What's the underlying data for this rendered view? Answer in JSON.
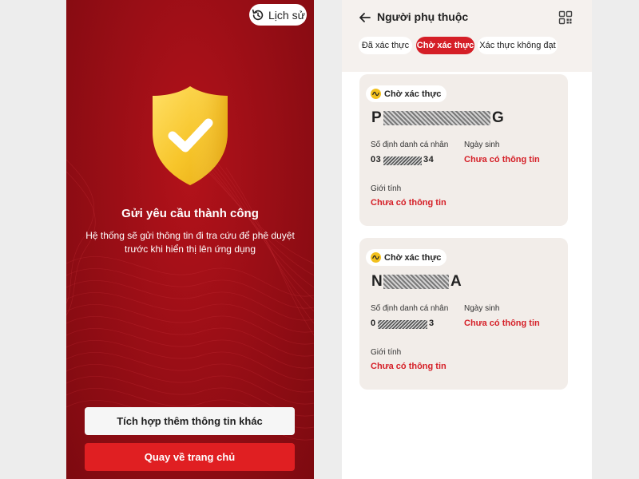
{
  "left_screen": {
    "history_label": "Lịch sử",
    "title": "Gửi yêu cầu thành công",
    "description": "Hệ thống sẽ gửi thông tin đi tra cứu để phê duyệt trước khi hiển thị lên ứng dụng",
    "btn_more_info": "Tích hợp thêm thông tin khác",
    "btn_home": "Quay về trang chủ",
    "colors": {
      "background": "#9a0e16",
      "primary_button": "#e01f22",
      "shield": "#f7c52a"
    }
  },
  "right_screen": {
    "title": "Người phụ thuộc",
    "tabs": [
      {
        "label": "Đã xác thực",
        "active": false
      },
      {
        "label": "Chờ xác thực",
        "active": true
      },
      {
        "label": "Xác thực không đạt",
        "active": false
      }
    ],
    "cards": [
      {
        "status": "Chờ xác thực",
        "name_first": "P",
        "name_last": "G",
        "id_label": "Số định danh cá nhân",
        "id_prefix": "03",
        "id_suffix": "34",
        "dob_label": "Ngày sinh",
        "dob_value": "Chưa có thông tin",
        "gender_label": "Giới tính",
        "gender_value": "Chưa có thông tin"
      },
      {
        "status": "Chờ xác thực",
        "name_first": "N",
        "name_last": "A",
        "id_label": "Số định danh cá nhân",
        "id_prefix": "0",
        "id_suffix": "3",
        "dob_label": "Ngày sinh",
        "dob_value": "Chưa có thông tin",
        "gender_label": "Giới tính",
        "gender_value": "Chưa có thông tin"
      }
    ],
    "colors": {
      "accent": "#d51f27",
      "header_bg": "#f5f1ee",
      "card_bg": "#f2ede9",
      "status_icon": "#f2c01e"
    }
  }
}
